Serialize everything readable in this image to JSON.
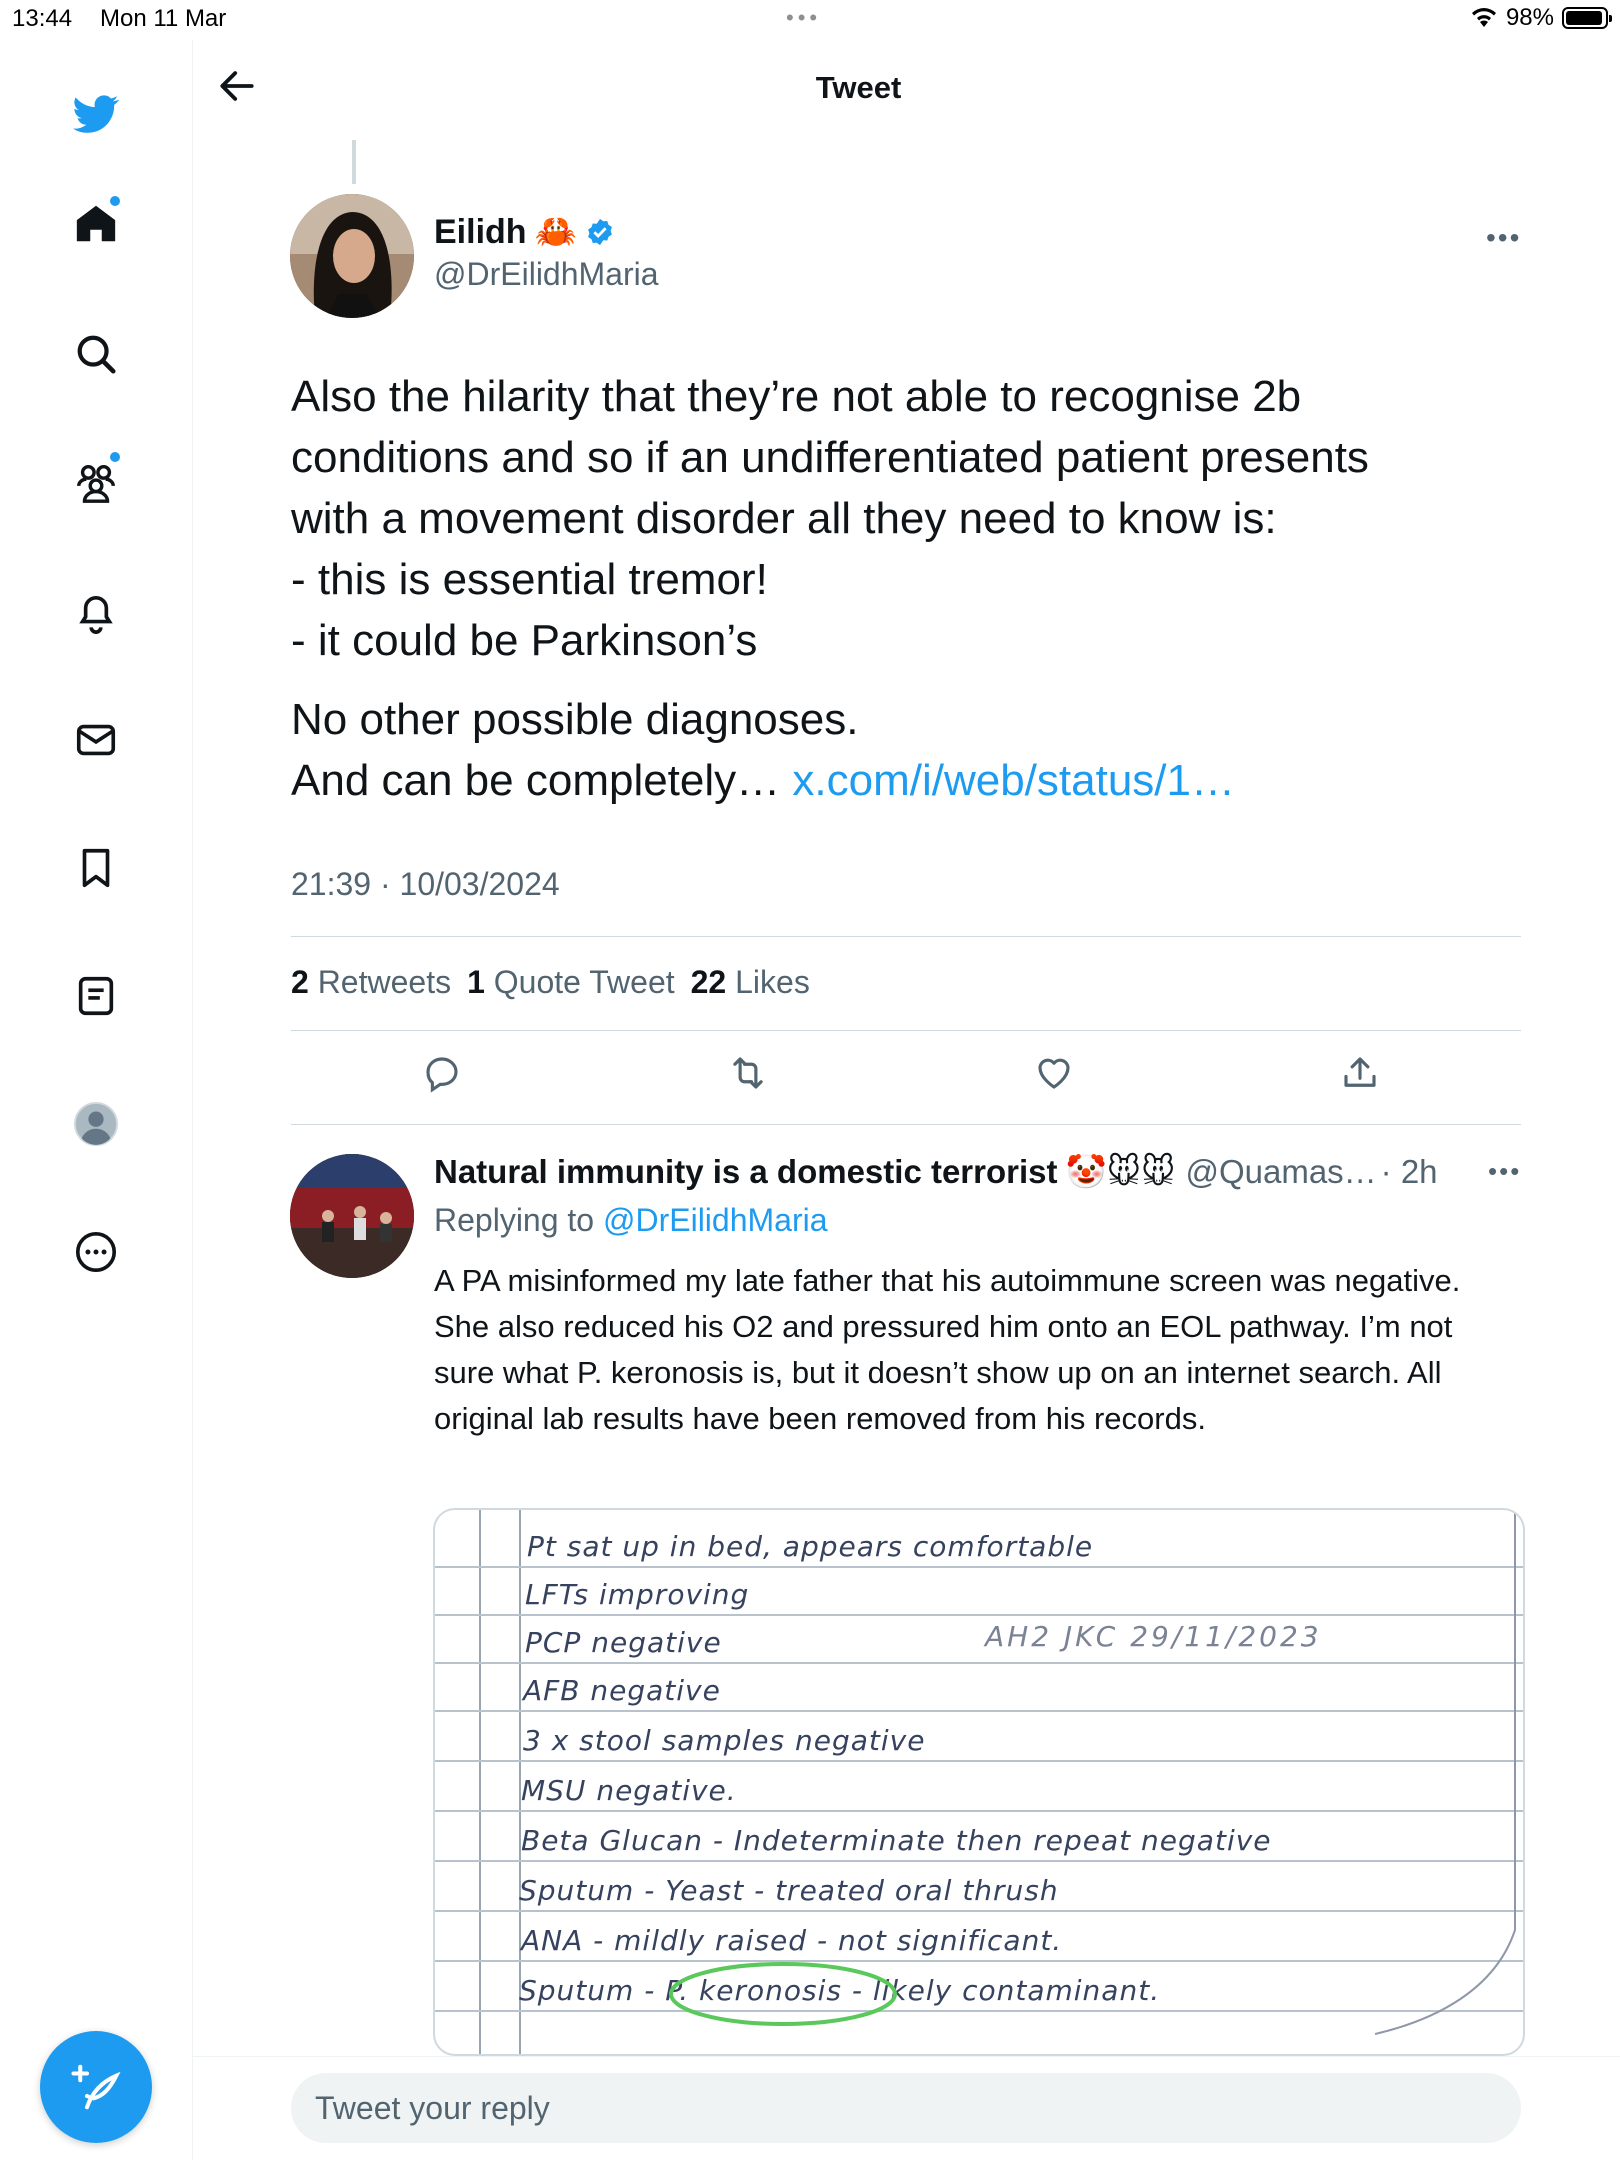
{
  "status_bar": {
    "time": "13:44",
    "date": "Mon 11 Mar",
    "battery": "98%"
  },
  "sidebar": {
    "items": [
      {
        "icon": "twitter-bird-icon"
      },
      {
        "icon": "home-icon",
        "unread": true
      },
      {
        "icon": "search-icon"
      },
      {
        "icon": "communities-icon",
        "unread": true
      },
      {
        "icon": "notifications-icon"
      },
      {
        "icon": "messages-icon"
      },
      {
        "icon": "bookmarks-icon"
      },
      {
        "icon": "lists-icon"
      },
      {
        "icon": "profile-avatar-icon"
      },
      {
        "icon": "more-icon"
      }
    ],
    "compose_icon": "compose-tweet-icon"
  },
  "header": {
    "title": "Tweet"
  },
  "tweet": {
    "author_name": "Eilidh",
    "author_emoji": "🦀",
    "verified": true,
    "handle": "@DrEilidhMaria",
    "lines": [
      "Also the hilarity that they’re not able to recognise 2b",
      "conditions and so if an undifferentiated patient presents",
      "with a movement disorder all they need to know is:",
      "- this is essential tremor!",
      "- it could be Parkinson’s"
    ],
    "line2a": "No other possible diagnoses.",
    "line2b": "And can be completely…",
    "link": "x.com/i/web/status/1…",
    "timestamp": "21:39 · 10/03/2024",
    "stats": {
      "retweets_count": "2",
      "retweets_label": "Retweets",
      "quotes_count": "1",
      "quotes_label": "Quote Tweet",
      "likes_count": "22",
      "likes_label": "Likes"
    }
  },
  "reply": {
    "name": "Natural immunity is a domestic terrorist",
    "emojis": "🤡🐭🐭",
    "handle": "@Quamas…",
    "time": "· 2h",
    "replying_prefix": "Replying to",
    "replying_to": "@DrEilidhMaria",
    "text": "A PA misinformed my late father that his autoimmune screen was negative. She also reduced his O2 and pressured him onto an EOL pathway. I’m not sure what P. keronosis is, but it doesn’t show up on an internet search. All original lab results have been removed from his records.",
    "notes": {
      "lines": [
        "Pt sat up in bed, appears comfortable",
        "LFTs improving",
        "PCP negative",
        "AFB negative",
        "3 x stool samples negative",
        "MSU negative.",
        "Beta Glucan - Indeterminate then repeat negative",
        "Sputum - Yeast - treated oral thrush",
        "ANA - mildly raised - not significant.",
        "Sputum - P. keronosis - likely contaminant."
      ],
      "signature": "AH2 JKC 29/11/2023"
    }
  },
  "reply_input": {
    "placeholder": "Tweet your reply"
  }
}
